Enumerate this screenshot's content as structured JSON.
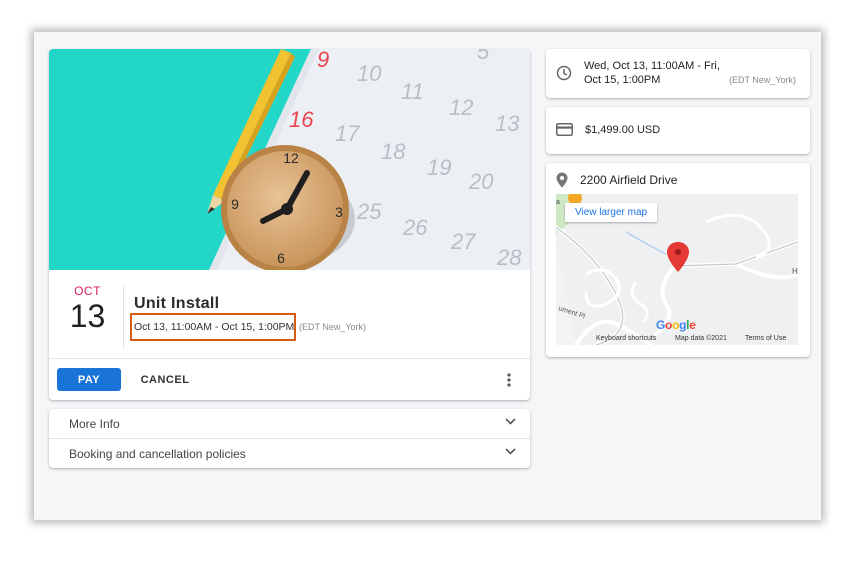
{
  "event": {
    "month": "OCT",
    "day": "13",
    "title": "Unit Install",
    "time_range": "Oct 13, 11:00AM - Oct 15, 1:00PM",
    "timezone": "(EDT New_York)"
  },
  "hero": {
    "calendar_numbers": [
      "9",
      "10",
      "11",
      "12",
      "13",
      "5",
      "16",
      "17",
      "18",
      "19",
      "20",
      "25",
      "26",
      "27",
      "28"
    ],
    "clock_numbers": [
      "12",
      "3",
      "6",
      "9"
    ]
  },
  "actions": {
    "pay_label": "PAY",
    "cancel_label": "CANCEL"
  },
  "accordions": [
    {
      "label": "More Info"
    },
    {
      "label": "Booking and cancellation policies"
    }
  ],
  "details": {
    "time_line1": "Wed, Oct 13, 11:00AM - Fri,",
    "time_line2": "Oct 15, 1:00PM",
    "time_tz": "(EDT New_York)",
    "price": "$1,499.00 USD",
    "address": "2200 Airfield Drive"
  },
  "map": {
    "view_larger": "View larger map",
    "google": [
      "G",
      "o",
      "o",
      "g",
      "l",
      "e"
    ],
    "google_colors": [
      "#4285F4",
      "#EA4335",
      "#FBBC05",
      "#4285F4",
      "#34A853",
      "#EA4335"
    ],
    "footer_shortcuts": "Keyboard shortcuts",
    "footer_data": "Map data ©2021",
    "footer_terms": "Terms of Use",
    "street_label": "ument Pl",
    "street_label_2": "H"
  },
  "colors": {
    "primary": "#1a73d6",
    "month_accent": "#d81b60",
    "highlight_border": "#d95a12",
    "hero_teal": "#22d6c8"
  },
  "icons": {
    "clock": "clock-icon",
    "price": "credit-card-icon",
    "location": "location-pin-icon",
    "more": "more-vert-icon",
    "chevron": "chevron-down-icon"
  }
}
